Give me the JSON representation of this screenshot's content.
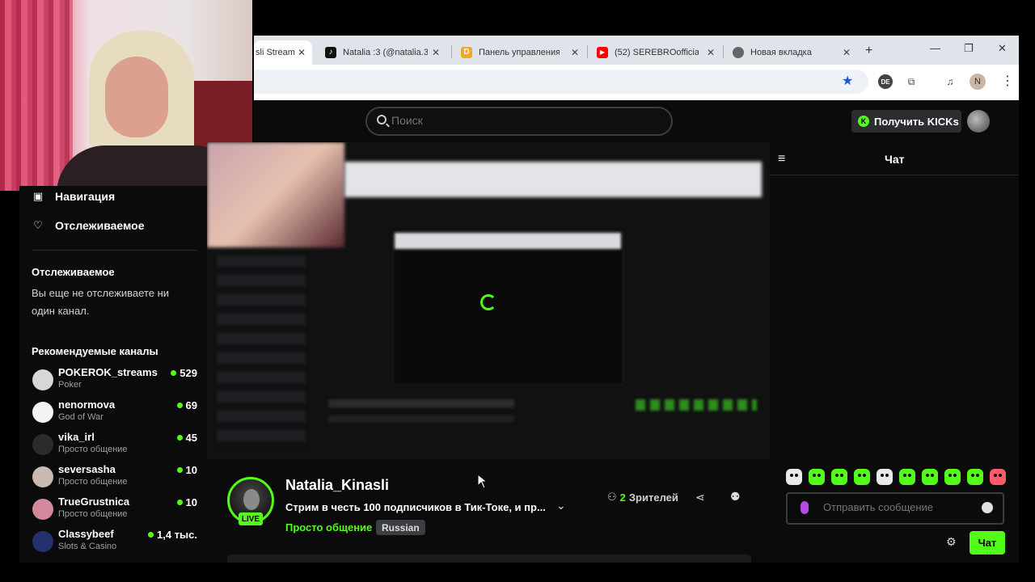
{
  "browser": {
    "tabs": [
      {
        "label": "sli Stream",
        "active": true,
        "icon": "kick-icon",
        "color": "#53fc18"
      },
      {
        "label": "Natalia :3 (@natalia.3",
        "icon": "tiktok-icon",
        "color": "#111111"
      },
      {
        "label": "Панель управления",
        "icon": "donation-icon",
        "color": "#f5a623"
      },
      {
        "label": "(52) SEREBROofficial",
        "icon": "youtube-icon",
        "color": "#ff0000"
      },
      {
        "label": "Новая вкладка",
        "icon": "chrome-icon",
        "color": "#555555"
      }
    ],
    "new_tab": "+",
    "profile_initial": "N",
    "ext_badge": "DE"
  },
  "header": {
    "search_placeholder": "Поиск",
    "kicks_button": "Получить KICKs"
  },
  "sidebar": {
    "nav": [
      {
        "label": "Навигация",
        "icon": "browse-icon"
      },
      {
        "label": "Отслеживаемое",
        "icon": "heart-icon"
      }
    ],
    "following_heading": "Отслеживаемое",
    "following_empty": "Вы еще не отслеживаете ни один канал.",
    "recommended_heading": "Рекомендуемые каналы",
    "channels": [
      {
        "name": "POKEROK_streams",
        "category": "Poker",
        "viewers": "529",
        "avatar": "#d7d7d7"
      },
      {
        "name": "nenormova",
        "category": "God of War",
        "viewers": "69",
        "avatar": "#f2f2f2"
      },
      {
        "name": "vika_irl",
        "category": "Просто общение",
        "viewers": "45",
        "avatar": "#2b2b2b"
      },
      {
        "name": "seversasha",
        "category": "Просто общение",
        "viewers": "10",
        "avatar": "#c9b9b0"
      },
      {
        "name": "TrueGrustnica",
        "category": "Просто общение",
        "viewers": "10",
        "avatar": "#d4889c"
      },
      {
        "name": "Classybeef",
        "category": "Slots & Casino",
        "viewers": "1,4 тыс.",
        "avatar": "#23306b"
      }
    ]
  },
  "stream": {
    "streamer": "Natalia_Kinasli",
    "title": "Стрим в честь 100 подписчиков в Тик-Токе, и пр...",
    "category": "Просто общение",
    "tag": "Russian",
    "live_badge": "LIVE",
    "viewers_count": "2",
    "viewers_label": "Зрителей"
  },
  "chat": {
    "title": "Чат",
    "input_placeholder": "Отправить сообщение",
    "send_button": "Чат"
  }
}
